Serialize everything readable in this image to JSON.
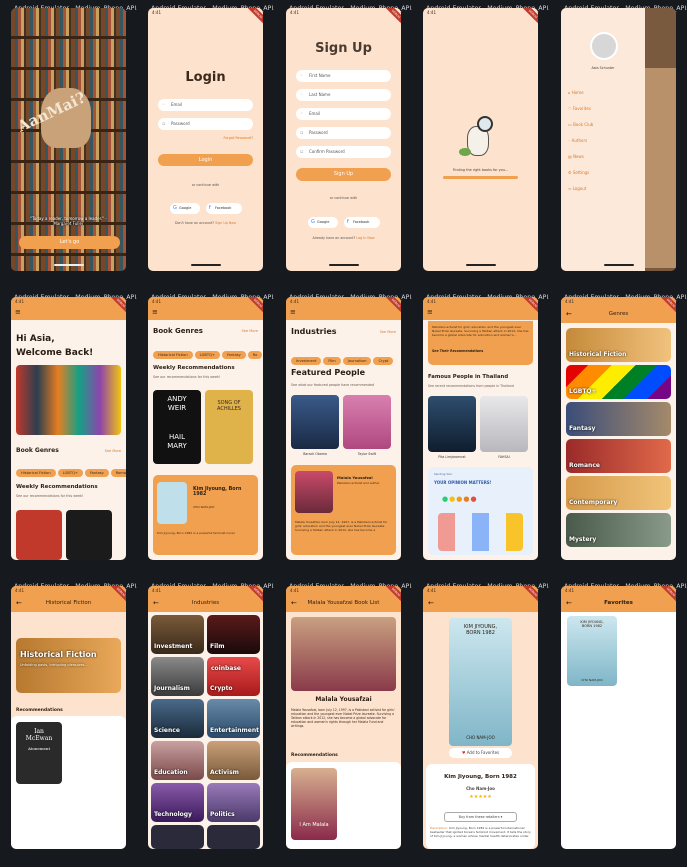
{
  "emulator_title": "Android Emulator - Medium_Phone_API...",
  "status_time": "4:41",
  "debug_label": "DEBUG",
  "screens": {
    "splash": {
      "logo": "AanMai?",
      "tagline": "\"Today a reader, tomorrow a leader.\" - Margaret Fuller",
      "button": "Let's go"
    },
    "login": {
      "title": "Login",
      "email_placeholder": "Email",
      "password_placeholder": "Password",
      "forgot": "Forgot Password?",
      "button": "Login",
      "or": "or continue with",
      "google": "Google",
      "facebook": "Facebook",
      "no_account": "Don't have an account?",
      "signup_link": "Sign Up Now"
    },
    "signup": {
      "title": "Sign Up",
      "fields": [
        "First Name",
        "Last Name",
        "Email",
        "Password",
        "Confirm Password"
      ],
      "button": "Sign Up",
      "or": "or continue with",
      "google": "Google",
      "facebook": "Facebook",
      "have_account": "Already have an account?",
      "login_link": "Log In Now"
    },
    "loading": {
      "text": "Finding the right books for you..."
    },
    "drawer": {
      "user": "Asia Schuster",
      "items": [
        "Home",
        "Favorites",
        "Book Club",
        "Authors",
        "News",
        "Settings",
        "Logout"
      ]
    },
    "home": {
      "greeting": "Hi Asia,",
      "welcome": "Welcome Back!",
      "book_genres": "Book Genres",
      "see_more": "See More",
      "genres": [
        "Historical Fiction",
        "LGBTQ+",
        "Fantasy",
        "Romance"
      ],
      "weekly": "Weekly Recommendations",
      "weekly_sub": "See our recommendations for this week!"
    },
    "home2": {
      "book_genres": "Book Genres",
      "see_more": "See More",
      "genres": [
        "Historical Fiction",
        "LGBTQ+",
        "Fantasy",
        "Ro"
      ],
      "weekly": "Weekly Recommendations",
      "weekly_sub": "See our recommendations for this week!",
      "book1_line1": "ANDY",
      "book1_line2": "WEIR",
      "book1_line3": "HAIL",
      "book1_line4": "MARY",
      "book2_line1": "SONG OF",
      "book2_line2": "ACHILLES",
      "featured_title": "Kim Jiyoung, Born 1982",
      "featured_author": "CHO NAM-JOO",
      "featured_text": "Kim Jiyoung, Born 1982 is a powerful feminist novel"
    },
    "home3": {
      "industries": "Industries",
      "see_more": "See More",
      "industry_chips": [
        "Investment",
        "Film",
        "Journalism",
        "Crypt"
      ],
      "featured": "Featured People",
      "featured_sub": "See what our featured people have recommended",
      "people": [
        "Barack Obama",
        "Taylor Swift"
      ],
      "card_name": "Malala Yousafzai",
      "card_role": "Pakistani activist and author",
      "card_text": "Malala Yousafzai, born July 12, 1997, is a Pakistani activist for girls' education and the youngest ever Nobel Prize laureate. Surviving a Taliban attack in 2012, she has become a"
    },
    "home4": {
      "top_text": "Pakistani activist for girls' education and the youngest ever Nobel Prize laureate. Surviving a Taliban attack in 2012, she has become a global advocate for education and women's...",
      "see_recs": "See Their Recommendations",
      "famous": "Famous People in Thailand",
      "famous_sub": "See recent recommendations from people in Thailand",
      "people": [
        "Pita Limjaroenrat",
        "FAHSAI"
      ],
      "opinion_small": "Sending Your",
      "opinion": "YOUR OPINION MATTERS!"
    },
    "genres": {
      "title": "Genres",
      "items": [
        "Historical Fiction",
        "LGBTQ+",
        "Fantasy",
        "Romance",
        "Contemporary",
        "Mystery"
      ]
    },
    "genre_detail": {
      "title": "Historical Fiction",
      "banner": "Historical Fiction",
      "banner_sub": "Unfolding pasts, intriguing pleasures...",
      "recs": "Recommendations",
      "book_line1": "Ian",
      "book_line2": "McEwan",
      "book_line3": "Atonement"
    },
    "industries": {
      "title": "Industries",
      "items": [
        "Investment",
        "Film",
        "Journalism",
        "Crypto",
        "Science",
        "Entertainment",
        "Education",
        "Activism",
        "Technology",
        "Politics"
      ],
      "crypto_badge": "coinbase"
    },
    "person_list": {
      "title": "Malala Yousafzai Book List",
      "name": "Malala Yousafzai",
      "bio": "Malala Yousafzai, born July 12, 1997, is a Pakistani activist for girls' education and the youngest ever Nobel Prize laureate. Surviving a Taliban attack in 2012, she has become a global advocate for education and women's rights through her Malala Fund and writings.",
      "recs": "Recommendations",
      "book": "I Am Malala"
    },
    "book_detail": {
      "cover_author_top": "KIM JIYOUNG,",
      "cover_title": "BORN 1982",
      "cover_author": "CHO NAM-JOO",
      "add_fav": "Add to Favorites",
      "title": "Kim Jiyoung, Born 1982",
      "author": "Cho Nam-Joo",
      "stars": "★★★★★",
      "rating": 4,
      "buy": "Buy from these retailers",
      "desc_label": "Description:",
      "desc": "Kim Jiyoung, Born 1982 is a powerful international bestseller that ignited Korea's feminist movement. It tells the story of Kim Jiyoung, a woman whose mental health deteriorates under"
    },
    "favorites": {
      "title": "Favorites",
      "book_top": "KIM JIYOUNG,",
      "book_title": "BORN 1982",
      "book_author": "CHO NAM-JOO"
    }
  },
  "colors": {
    "accent": "#f0a04f",
    "background": "#fde2cd",
    "frame": "#161a1f"
  }
}
